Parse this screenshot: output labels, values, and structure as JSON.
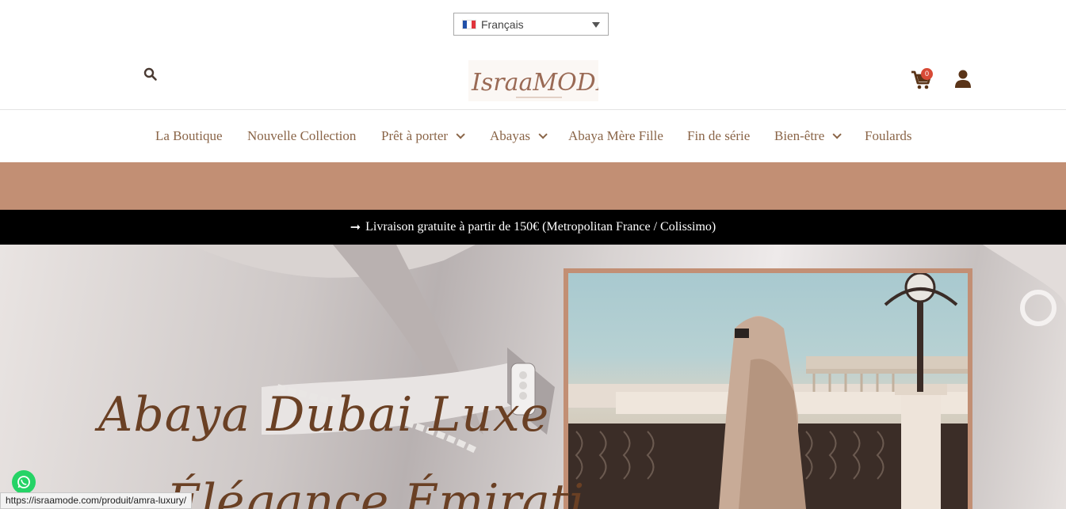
{
  "language_selector": {
    "value": "Français",
    "flag": "fr-flag"
  },
  "header": {
    "logo_text": "IsraaMODE",
    "cart_count": "0",
    "icons": {
      "search": "search-icon",
      "cart": "cart-icon",
      "account": "user-icon"
    }
  },
  "nav": {
    "items": [
      {
        "label": "La Boutique",
        "dropdown": false
      },
      {
        "label": "Nouvelle Collection",
        "dropdown": false
      },
      {
        "label": "Prêt à porter",
        "dropdown": true
      },
      {
        "label": "Abayas",
        "dropdown": true
      },
      {
        "label": "Abaya Mère Fille",
        "dropdown": false
      },
      {
        "label": "Fin de série",
        "dropdown": false
      },
      {
        "label": "Bien-être",
        "dropdown": true
      },
      {
        "label": "Foulards",
        "dropdown": false
      }
    ]
  },
  "promo": {
    "text": "Livraison gratuite à partir de 150€ (Metropolitan France / Colissimo)"
  },
  "hero": {
    "title": "Abaya Dubai Luxe",
    "subtitle": "Élégance Émirati"
  },
  "status_bar": {
    "url": "https://israamode.com/produit/amra-luxury/"
  },
  "colors": {
    "brand_brown": "#8a6548",
    "band_tan": "#c28f74",
    "promo_black": "#000000",
    "title_brown": "#6a4024",
    "badge_red": "#d84a36"
  }
}
